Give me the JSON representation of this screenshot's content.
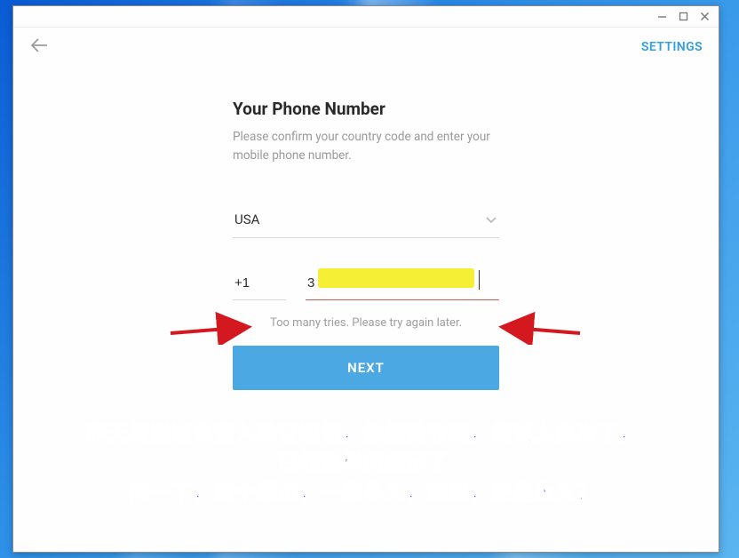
{
  "titlebar": {
    "min_label": "minimize",
    "max_label": "maximize",
    "close_label": "close"
  },
  "topbar": {
    "settings_label": "SETTINGS"
  },
  "form": {
    "title": "Your Phone Number",
    "subtitle": "Please confirm your country code and enter your mobile phone number.",
    "country": "USA",
    "dial_code": "+1",
    "phone_display": "3",
    "error": "Too many tries. Please try again later.",
    "next_label": "NEXT"
  },
  "annotation": {
    "line1": "昨天发送过多登入验证短信，依然没收到，尝试太多次了，",
    "line2": "已经这样的提示了",
    "line3": "问一下，这个提示，一般多久，解封，还是永久？"
  }
}
